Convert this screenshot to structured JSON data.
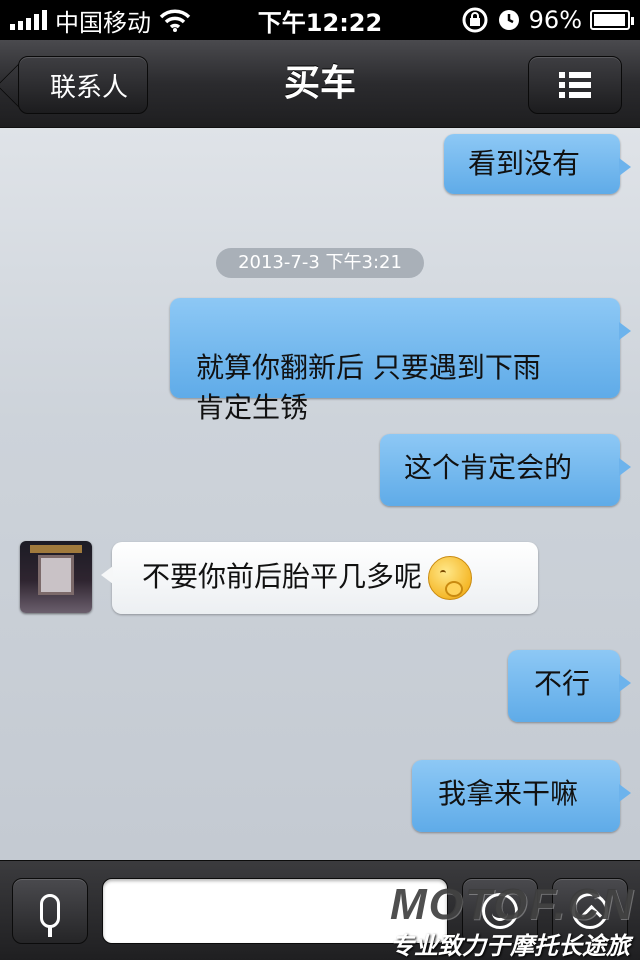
{
  "status_bar": {
    "carrier": "中国移动",
    "time": "下午12:22",
    "battery_percent": "96%",
    "battery_level": 0.96,
    "icons": [
      "signal-icon",
      "wifi-icon",
      "rotation-lock-icon",
      "alarm-icon",
      "battery-icon"
    ]
  },
  "nav": {
    "back_label": "联系人",
    "title": "买车",
    "menu_icon": "list-icon"
  },
  "chat": {
    "timestamp": "2013-7-3 下午3:21",
    "messages": [
      {
        "side": "out",
        "text": "看到没有"
      },
      {
        "side": "out",
        "text": "就算你翻新后 只要遇到下雨\n肯定生锈"
      },
      {
        "side": "out",
        "text": "这个肯定会的"
      },
      {
        "side": "in",
        "text": "不要你前后胎平几多呢",
        "emoji": "covering-mouth-emoji"
      },
      {
        "side": "out",
        "text": "不行"
      },
      {
        "side": "out",
        "text": "我拿来干嘛"
      }
    ]
  },
  "input_bar": {
    "voice_icon": "microphone-icon",
    "input_value": "",
    "emoji_icon": "smiley-icon",
    "more_icon": "chevron-up-icon"
  },
  "watermark": {
    "logo": "MOTOF.CN",
    "slogan": "专业致力于摩托长途旅行"
  },
  "colors": {
    "outgoing_bubble": "#6db3ec",
    "incoming_bubble": "#ffffff",
    "nav_bar": "#2b2b2e",
    "chat_background": "#cdd3da"
  }
}
